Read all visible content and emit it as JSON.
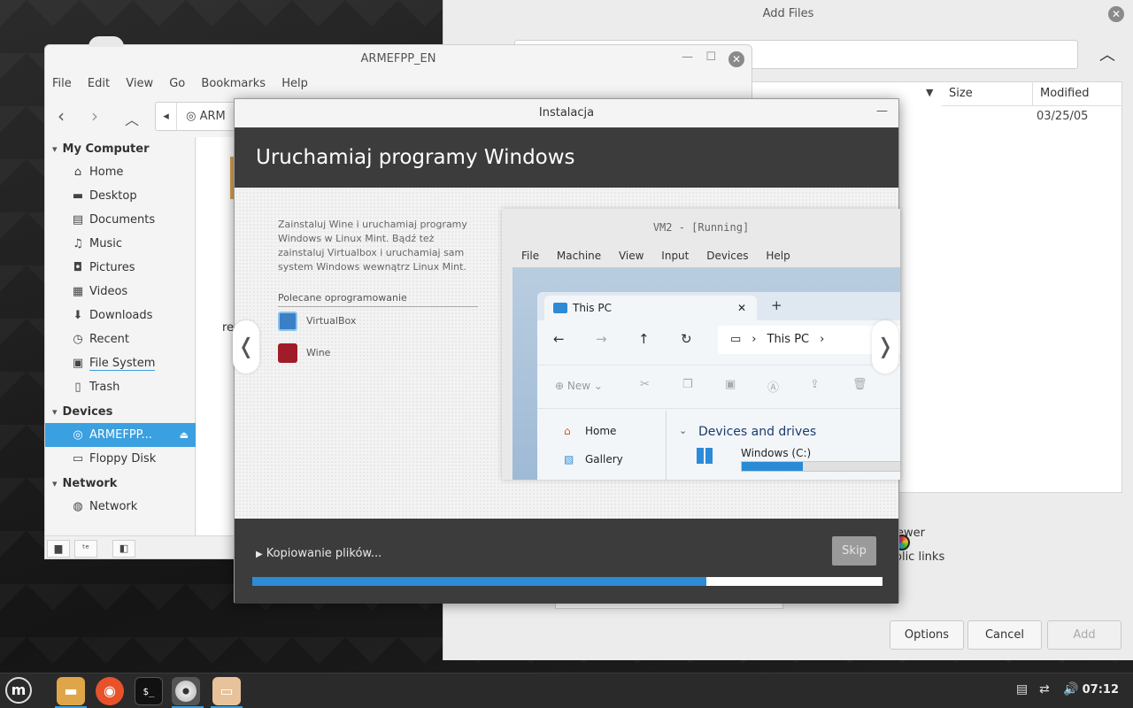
{
  "add_files": {
    "title": "Add Files",
    "columns": {
      "size": "Size",
      "modified": "Modified"
    },
    "row_modified": "03/25/05",
    "option_viewer": "ewer",
    "option_links": "olic links",
    "buttons": {
      "options": "Options",
      "cancel": "Cancel",
      "add": "Add"
    }
  },
  "nemo": {
    "title": "ARMEFPP_EN",
    "menu": [
      "File",
      "Edit",
      "View",
      "Go",
      "Bookmarks",
      "Help"
    ],
    "location": "ARM",
    "content_partial_label": "re",
    "sections": {
      "my_computer": "My Computer",
      "devices": "Devices",
      "network": "Network"
    },
    "places": [
      {
        "label": "Home",
        "icon": "⌂"
      },
      {
        "label": "Desktop",
        "icon": "▬"
      },
      {
        "label": "Documents",
        "icon": "▤"
      },
      {
        "label": "Music",
        "icon": "♫"
      },
      {
        "label": "Pictures",
        "icon": "◘"
      },
      {
        "label": "Videos",
        "icon": "▦"
      },
      {
        "label": "Downloads",
        "icon": "⬇"
      },
      {
        "label": "Recent",
        "icon": "◷"
      },
      {
        "label": "File System",
        "icon": "▣"
      },
      {
        "label": "Trash",
        "icon": "▯"
      }
    ],
    "devices": [
      {
        "label": "ARMEFPP...",
        "icon": "◎"
      },
      {
        "label": "Floppy Disk",
        "icon": "▭"
      }
    ],
    "network": [
      {
        "label": "Network",
        "icon": "◍"
      }
    ]
  },
  "installer": {
    "title": "Instalacja",
    "banner": "Uruchamiaj programy Windows",
    "description": "Zainstaluj Wine i uruchamiaj programy Windows w Linux Mint. Bądź też zainstaluj Virtualbox i uruchamiaj sam system Windows wewnątrz Linux Mint.",
    "recommended_heading": "Polecane oprogramowanie",
    "apps": [
      "VirtualBox",
      "Wine"
    ],
    "progress_label": "Kopiowanie plików...",
    "progress": 0.72,
    "skip": "Skip",
    "vbox": {
      "title": "VM2 - [Running]",
      "menu": [
        "File",
        "Machine",
        "View",
        "Input",
        "Devices",
        "Help"
      ],
      "tab": "This PC",
      "address": "This PC",
      "new_label": "New",
      "nav_home": "Home",
      "nav_gallery": "Gallery",
      "devices_heading": "Devices and drives",
      "drive_label": "Windows (C:)",
      "drive_used": 0.35
    }
  },
  "taskbar": {
    "clock": "07:12"
  },
  "colors": {
    "accent": "#3ba0e0",
    "progress": "#2e8bd6",
    "banner": "#3c3c3c"
  }
}
